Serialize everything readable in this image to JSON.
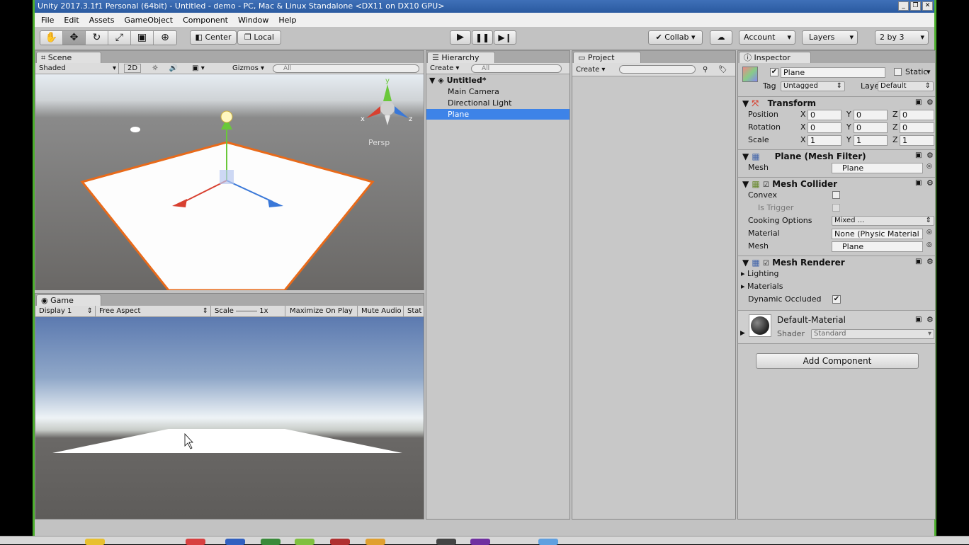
{
  "window": {
    "title": "Unity 2017.3.1f1 Personal (64bit) - Untitled - demo - PC, Mac & Linux Standalone <DX11 on DX10 GPU>"
  },
  "menu": [
    "File",
    "Edit",
    "Assets",
    "GameObject",
    "Component",
    "Window",
    "Help"
  ],
  "toolbar": {
    "center": "Center",
    "local": "Local",
    "collab": "Collab",
    "account": "Account",
    "layers": "Layers",
    "layout": "2 by 3"
  },
  "scene": {
    "tab": "Scene",
    "shading": "Shaded",
    "mode2d": "2D",
    "gizmos": "Gizmos",
    "search_placeholder": "All",
    "persp": "Persp"
  },
  "game": {
    "tab": "Game",
    "display": "Display 1",
    "aspect": "Free Aspect",
    "scale_label": "Scale",
    "scale_value": "1x",
    "maximize": "Maximize On Play",
    "mute": "Mute Audio",
    "stats": "Stat"
  },
  "hierarchy": {
    "tab": "Hierarchy",
    "create": "Create",
    "search_placeholder": "All",
    "scene_name": "Untitled*",
    "items": [
      "Main Camera",
      "Directional Light",
      "Plane"
    ],
    "selected": "Plane"
  },
  "project": {
    "tab": "Project",
    "create": "Create"
  },
  "inspector": {
    "tab": "Inspector",
    "object_name": "Plane",
    "static": "Static",
    "tag_label": "Tag",
    "tag": "Untagged",
    "layer_label": "Layer",
    "layer": "Default",
    "transform": {
      "title": "Transform",
      "position_label": "Position",
      "rotation_label": "Rotation",
      "scale_label": "Scale",
      "position": {
        "x": "0",
        "y": "0",
        "z": "0"
      },
      "rotation": {
        "x": "0",
        "y": "0",
        "z": "0"
      },
      "scale": {
        "x": "1",
        "y": "1",
        "z": "1"
      }
    },
    "mesh_filter": {
      "title": "Plane (Mesh Filter)",
      "mesh_label": "Mesh",
      "mesh": "Plane"
    },
    "mesh_collider": {
      "title": "Mesh Collider",
      "convex": "Convex",
      "is_trigger": "Is Trigger",
      "cooking_label": "Cooking Options",
      "cooking": "Mixed ...",
      "material_label": "Material",
      "material": "None (Physic Material",
      "mesh_label": "Mesh",
      "mesh": "Plane"
    },
    "mesh_renderer": {
      "title": "Mesh Renderer",
      "lighting": "Lighting",
      "materials": "Materials",
      "dynamic_occluded": "Dynamic Occluded"
    },
    "material": {
      "name": "Default-Material",
      "shader_label": "Shader",
      "shader": "Standard"
    },
    "add_component": "Add Component"
  }
}
